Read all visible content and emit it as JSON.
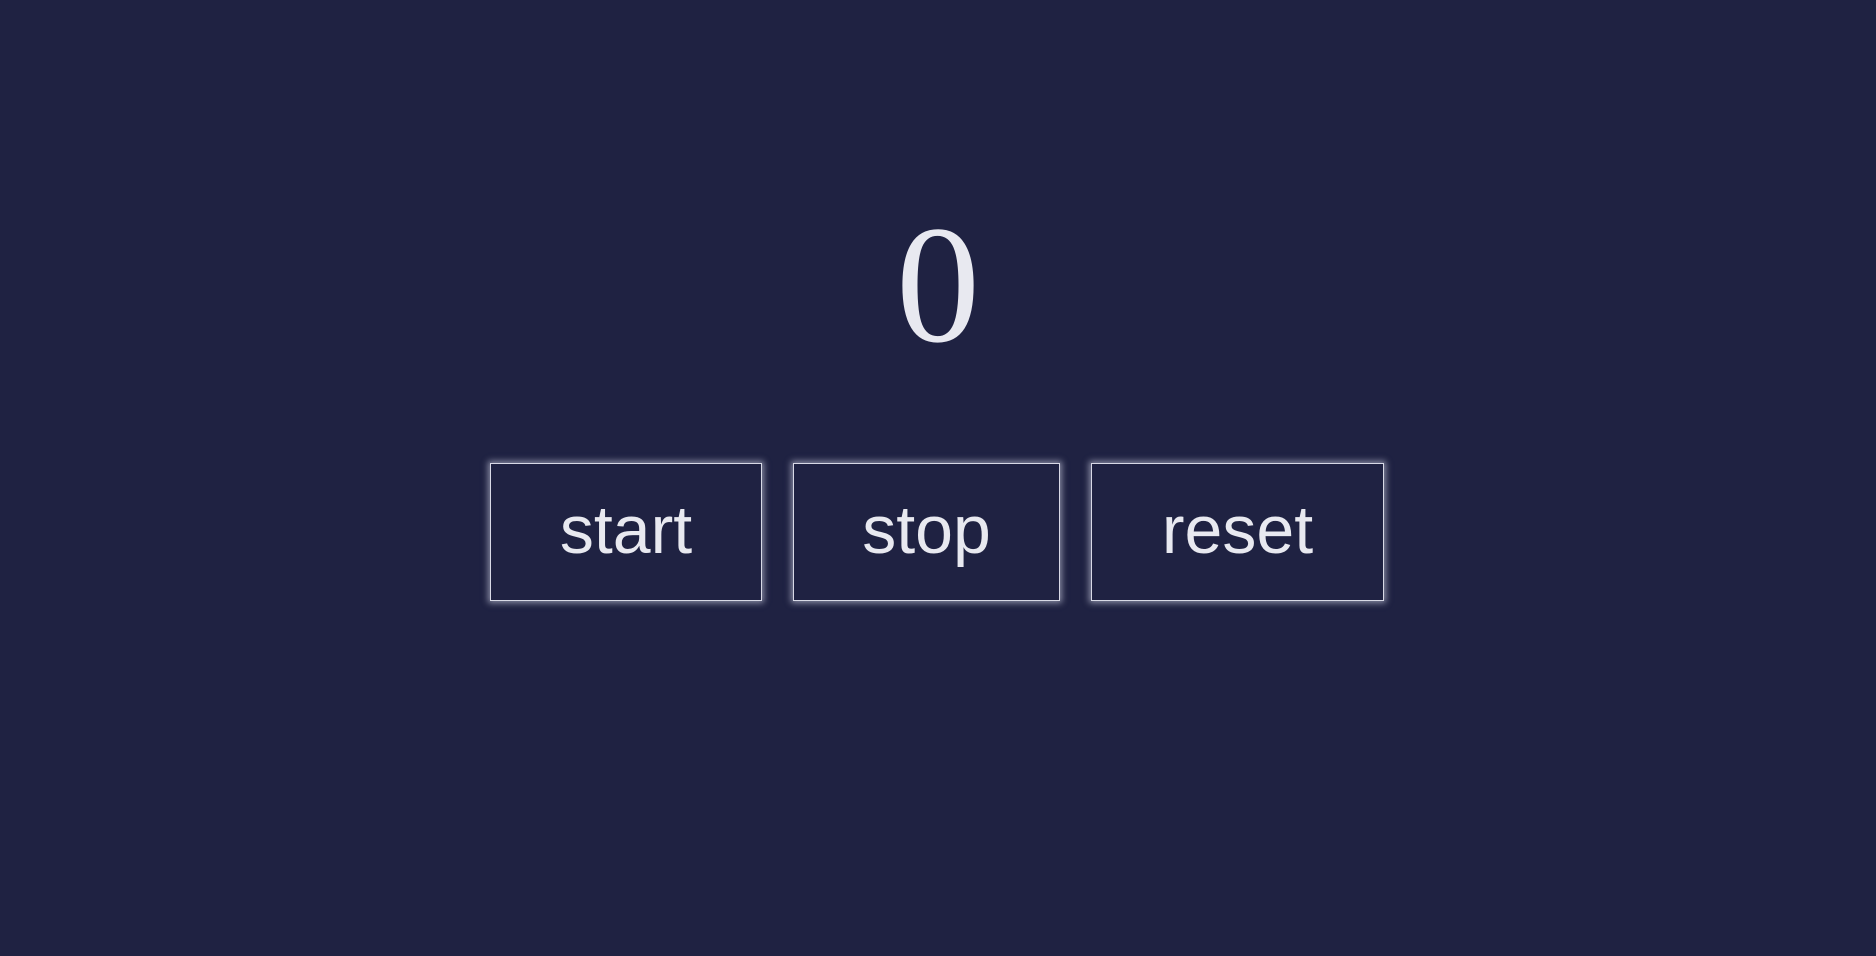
{
  "counter": {
    "value": "0"
  },
  "controls": {
    "start_label": "start",
    "stop_label": "stop",
    "reset_label": "reset"
  },
  "colors": {
    "background": "#1f2242",
    "text": "#e8e9f0",
    "button_border": "#d8d9e6"
  }
}
